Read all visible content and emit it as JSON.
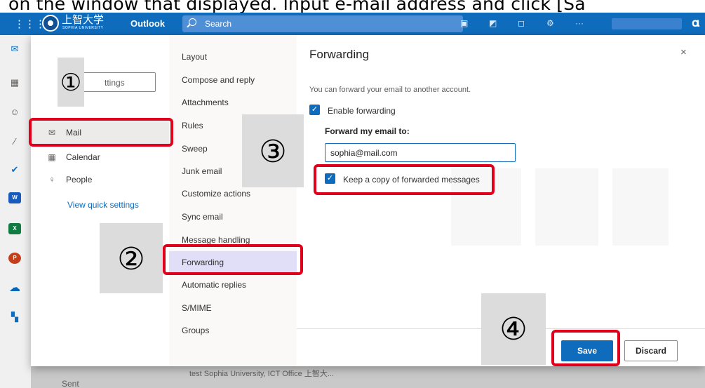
{
  "caption": "on the window that displayed. Input e-mail address and click [Sa",
  "topbar": {
    "org_name": "上智大学",
    "org_subtitle": "SOPHIA UNIVERSITY",
    "app_name": "Outlook",
    "search_placeholder": "Search",
    "icons": [
      "waffle-icon",
      "teams-icon",
      "sticky-notes-icon",
      "bell-icon",
      "gear-icon",
      "more-icon"
    ]
  },
  "rail": [
    "mail-icon",
    "calendar-icon",
    "people-icon",
    "attach-icon",
    "todo-icon",
    "word-icon",
    "excel-icon",
    "powerpoint-icon",
    "onedrive-icon",
    "more-apps-icon"
  ],
  "settings": {
    "search_placeholder": "Search settings",
    "search_visible": "ttings",
    "nav": [
      {
        "label": "Mail",
        "icon": "mail-icon",
        "selected": true
      },
      {
        "label": "Calendar",
        "icon": "calendar-icon",
        "selected": false
      },
      {
        "label": "People",
        "icon": "people-icon",
        "selected": false
      }
    ],
    "quick_link": "View quick settings"
  },
  "mail_nav": [
    {
      "label": "Layout"
    },
    {
      "label": "Compose and reply"
    },
    {
      "label": "Attachments"
    },
    {
      "label": "Rules"
    },
    {
      "label": "Sweep"
    },
    {
      "label": "Junk email"
    },
    {
      "label": "Customize actions"
    },
    {
      "label": "Sync email"
    },
    {
      "label": "Message handling"
    },
    {
      "label": "Forwarding",
      "selected": true
    },
    {
      "label": "Automatic replies"
    },
    {
      "label": "S/MIME"
    },
    {
      "label": "Groups"
    }
  ],
  "pane": {
    "title": "Forwarding",
    "close_glyph": "×",
    "description": "You can forward your email to another account.",
    "enable_label": "Enable forwarding",
    "enable_checked": true,
    "forward_to_label": "Forward my email to:",
    "forward_to_value": "sophia@mail.com",
    "keep_copy_label": "Keep a copy of forwarded messages",
    "keep_copy_checked": true,
    "save_label": "Save",
    "discard_label": "Discard"
  },
  "background": {
    "folder_sent": "Sent",
    "preview_text": "test Sophia University, ICT Office 上智大..."
  },
  "annotations": {
    "step1": "①",
    "step2": "②",
    "step3": "③",
    "step4": "④",
    "highlight_color": "#e0001b"
  },
  "colors": {
    "accent": "#0f6cbd",
    "selected_nav": "#e1dff7"
  }
}
